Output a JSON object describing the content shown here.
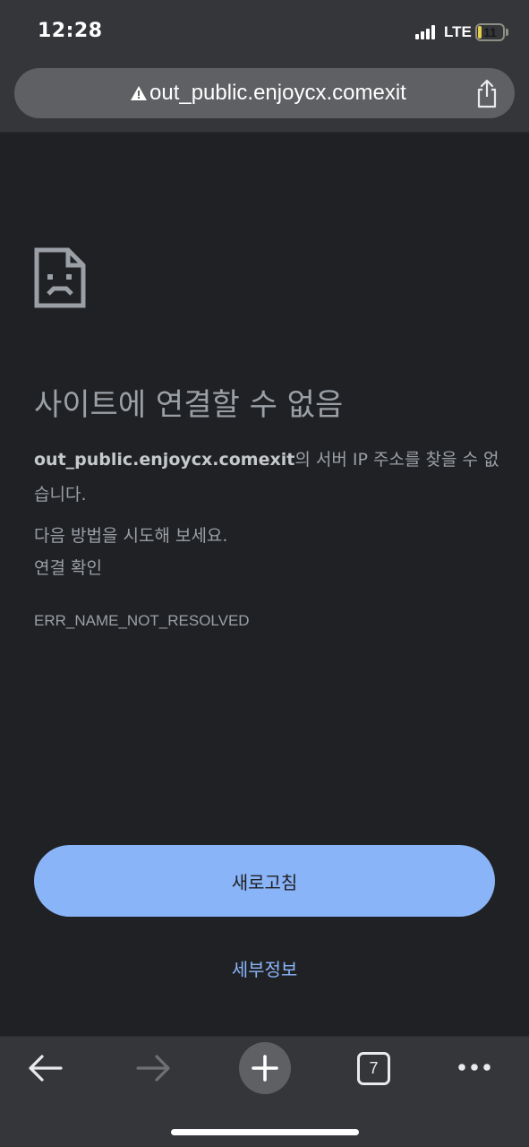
{
  "status_bar": {
    "time": "12:28",
    "network": "LTE",
    "battery_level": "11",
    "battery_fraction": 0.11,
    "battery_color": "#e3d048"
  },
  "address_bar": {
    "url": "out_public.enjoycx.comexit",
    "security_icon": "warning-icon",
    "share_icon": "share-icon"
  },
  "error_page": {
    "icon": "sad-document-icon",
    "title": "사이트에 연결할 수 없음",
    "host": "out_public.enjoycx.comexit",
    "description_suffix": "의 서버 IP 주소를 찾을 수 없습니다.",
    "suggestion_heading": "다음 방법을 시도해 보세요.",
    "suggestion_item": "연결 확인",
    "error_code": "ERR_NAME_NOT_RESOLVED",
    "reload_label": "새로고침",
    "details_label": "세부정보",
    "accent_color": "#8ab4f8"
  },
  "toolbar": {
    "back_icon": "arrow-left-icon",
    "forward_icon": "arrow-right-icon",
    "new_tab_icon": "plus-icon",
    "tab_count": "7",
    "menu_icon": "more-horizontal-icon"
  }
}
